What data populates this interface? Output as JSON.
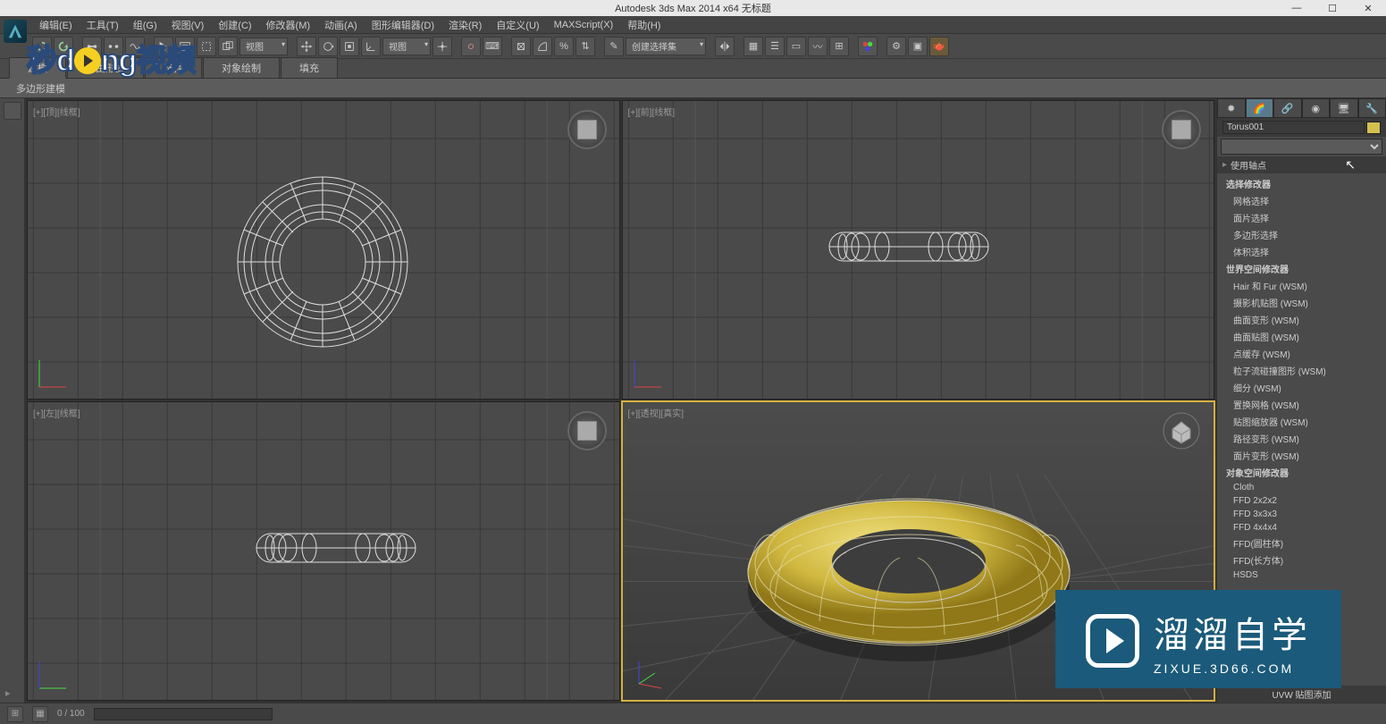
{
  "title": "Autodesk 3ds Max  2014 x64    无标题",
  "menu": {
    "items": [
      {
        "label": "编辑(E)"
      },
      {
        "label": "工具(T)"
      },
      {
        "label": "组(G)"
      },
      {
        "label": "视图(V)"
      },
      {
        "label": "创建(C)"
      },
      {
        "label": "修改器(M)"
      },
      {
        "label": "动画(A)"
      },
      {
        "label": "图形编辑器(D)"
      },
      {
        "label": "渲染(R)"
      },
      {
        "label": "自定义(U)"
      },
      {
        "label": "MAXScript(X)"
      },
      {
        "label": "帮助(H)"
      }
    ]
  },
  "toolbar": {
    "dropdowns": {
      "view": "视图",
      "selection": "创建选择集"
    }
  },
  "ribbon": {
    "tabs": [
      {
        "label": "建模",
        "active": true
      },
      {
        "label": "自由形式"
      },
      {
        "label": "选择"
      },
      {
        "label": "对象绘制"
      },
      {
        "label": "填充"
      }
    ],
    "sub": "多边形建模"
  },
  "viewports": {
    "tl": "[+][顶][线框]",
    "tr": "[+][前][线框]",
    "bl": "[+][左][线框]",
    "br": "[+][透视][真实]"
  },
  "panel": {
    "object_name": "Torus001",
    "modifier_dropdown": "",
    "section_main": "使用轴点",
    "modifier_groups": [
      {
        "label": "选择修改器",
        "items": [
          "网格选择",
          "面片选择",
          "多边形选择",
          "体积选择"
        ]
      },
      {
        "label": "世界空间修改器",
        "items": [
          "Hair 和 Fur (WSM)",
          "摄影机贴图 (WSM)",
          "曲面变形 (WSM)",
          "曲面贴图 (WSM)",
          "点缓存 (WSM)",
          "粒子流碰撞图形 (WSM)",
          "细分 (WSM)",
          "置换网格 (WSM)",
          "贴图缩放器 (WSM)",
          "路径变形 (WSM)",
          "面片变形 (WSM)"
        ]
      },
      {
        "label": "对象空间修改器",
        "items": [
          "Cloth",
          "FFD 2x2x2",
          "FFD 3x3x3",
          "FFD 4x4x4",
          "FFD(圆柱体)",
          "FFD(长方体)",
          "HSDS"
        ]
      }
    ],
    "footer_item": "UVW 贴图添加"
  },
  "status": {
    "frame": "0 / 100"
  },
  "watermarks": {
    "left_pre": "秒d",
    "left_mid": "ng",
    "left_post": "视频",
    "right_cn": "溜溜自学",
    "right_en": "ZIXUE.3D66.COM"
  }
}
